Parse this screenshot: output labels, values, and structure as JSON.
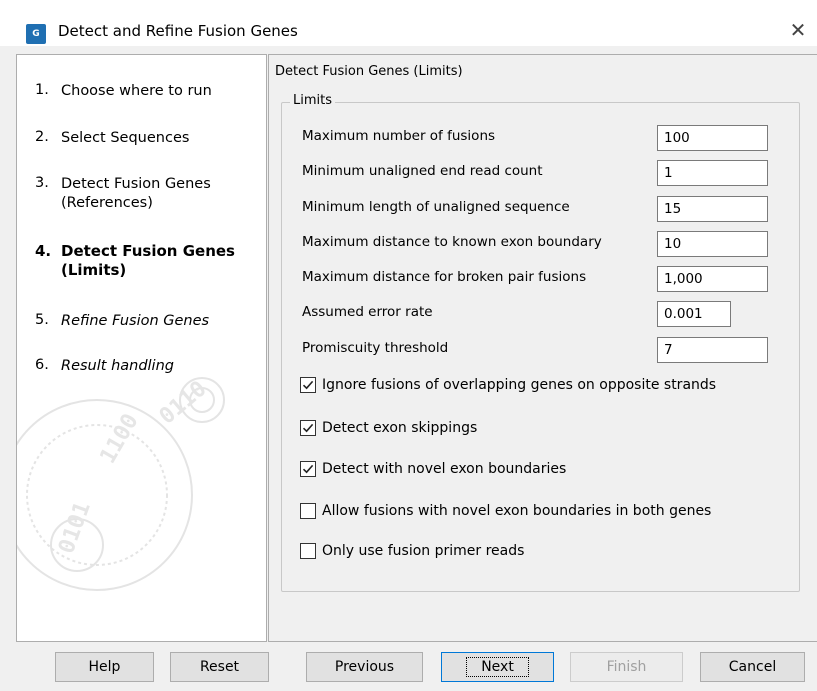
{
  "window": {
    "title": "Detect and Refine Fusion Genes",
    "app_icon_text": "G",
    "close_glyph": "✕"
  },
  "steps": [
    {
      "num": "1.",
      "label": "Choose where to run",
      "state": "done"
    },
    {
      "num": "2.",
      "label": "Select Sequences",
      "state": "done"
    },
    {
      "num": "3.",
      "label": "Detect Fusion Genes (References)",
      "state": "done"
    },
    {
      "num": "4.",
      "label": "Detect Fusion Genes (Limits)",
      "state": "active"
    },
    {
      "num": "5.",
      "label": "Refine Fusion Genes",
      "state": "future"
    },
    {
      "num": "6.",
      "label": "Result handling",
      "state": "future"
    }
  ],
  "panel": {
    "section_title": "Detect Fusion Genes (Limits)",
    "group_label": "Limits",
    "fields": [
      {
        "label": "Maximum number of fusions",
        "value": "100"
      },
      {
        "label": "Minimum unaligned end read count",
        "value": "1"
      },
      {
        "label": "Minimum length of unaligned sequence",
        "value": "15"
      },
      {
        "label": "Maximum distance to known exon boundary",
        "value": "10"
      },
      {
        "label": "Maximum distance for broken pair fusions",
        "value": "1,000"
      },
      {
        "label": "Assumed error rate",
        "value": "0.001"
      },
      {
        "label": "Promiscuity threshold",
        "value": "7"
      }
    ],
    "checkboxes": [
      {
        "label": "Ignore fusions of overlapping genes on opposite strands",
        "checked": true
      },
      {
        "label": "Detect exon skippings",
        "checked": true
      },
      {
        "label": "Detect with novel exon boundaries",
        "checked": true
      },
      {
        "label": "Allow fusions with novel exon boundaries in both genes",
        "checked": false
      },
      {
        "label": "Only use fusion primer reads",
        "checked": false
      }
    ]
  },
  "buttons": {
    "help": "Help",
    "reset": "Reset",
    "previous": "Previous",
    "next": "Next",
    "finish": "Finish",
    "cancel": "Cancel"
  }
}
